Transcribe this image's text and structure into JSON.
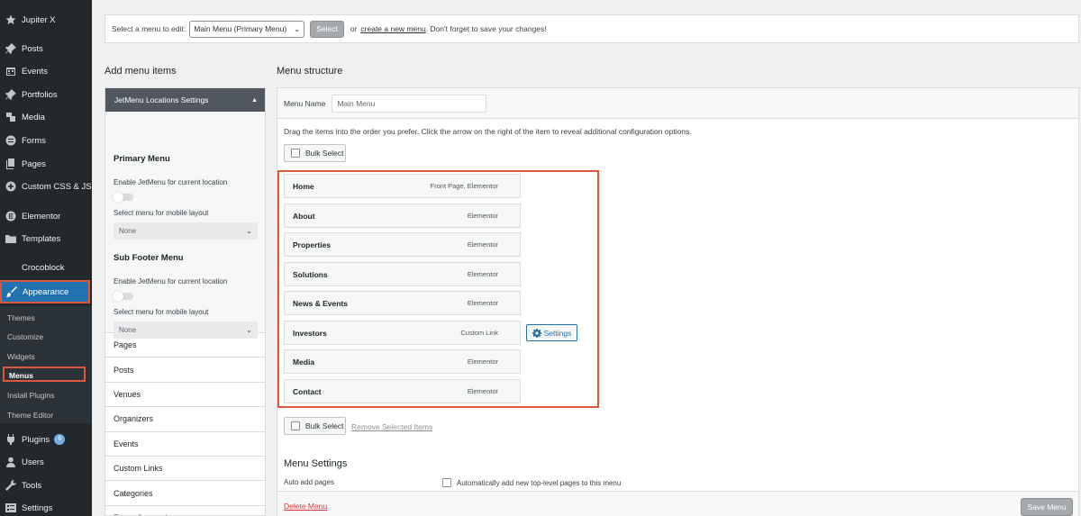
{
  "sidebar": {
    "items": [
      {
        "label": "Jupiter X",
        "icon": "star-icon"
      },
      {
        "label": "Posts",
        "icon": "pin-icon"
      },
      {
        "label": "Events",
        "icon": "calendar-icon"
      },
      {
        "label": "Portfolios",
        "icon": "pin-icon"
      },
      {
        "label": "Media",
        "icon": "media-icon"
      },
      {
        "label": "Forms",
        "icon": "forms-icon"
      },
      {
        "label": "Pages",
        "icon": "pages-icon"
      },
      {
        "label": "Custom CSS & JS",
        "icon": "plus-circle-icon"
      },
      {
        "label": "Elementor",
        "icon": "elementor-icon"
      },
      {
        "label": "Templates",
        "icon": "folder-icon"
      },
      {
        "label": "Crocoblock",
        "icon": "moon-icon"
      },
      {
        "label": "Appearance",
        "icon": "brush-icon"
      },
      {
        "label": "Plugins",
        "icon": "plug-icon",
        "badge": "6"
      },
      {
        "label": "Users",
        "icon": "user-icon"
      },
      {
        "label": "Tools",
        "icon": "wrench-icon"
      },
      {
        "label": "Settings",
        "icon": "settings-icon"
      }
    ],
    "submenu": [
      "Themes",
      "Customize",
      "Widgets",
      "Menus",
      "Install Plugins",
      "Theme Editor"
    ]
  },
  "select_bar": {
    "label": "Select a menu to edit:",
    "selected": "Main Menu (Primary Menu)",
    "select_button": "Select",
    "or": "or",
    "create_link": "create a new menu",
    "suffix": ". Don't forget to save your changes!"
  },
  "left": {
    "heading": "Add menu items",
    "jet_header": "JetMenu Locations Settings",
    "primary_title": "Primary Menu",
    "sub_footer_title": "Sub Footer Menu",
    "enable_label": "Enable JetMenu for current location",
    "mobile_label": "Select menu for mobile layout",
    "mobile_value": "None",
    "accordion": [
      "Pages",
      "Posts",
      "Venues",
      "Organizers",
      "Events",
      "Custom Links",
      "Categories",
      "Event Categories"
    ]
  },
  "right": {
    "heading": "Menu structure",
    "menu_name_label": "Menu Name",
    "menu_name_value": "Main Menu",
    "instructions": "Drag the items into the order you prefer. Click the arrow on the right of the item to reveal additional configuration options.",
    "bulk_select": "Bulk Select",
    "remove_selected": "Remove Selected Items",
    "settings_button": "Settings",
    "items": [
      {
        "title": "Home",
        "type": "Front Page, Elementor"
      },
      {
        "title": "About",
        "type": "Elementor"
      },
      {
        "title": "Properties",
        "type": "Elementor"
      },
      {
        "title": "Solutions",
        "type": "Elementor"
      },
      {
        "title": "News & Events",
        "type": "Elementor"
      },
      {
        "title": "Investors",
        "type": "Custom Link"
      },
      {
        "title": "Media",
        "type": "Elementor"
      },
      {
        "title": "Contact",
        "type": "Elementor"
      }
    ],
    "menu_settings_title": "Menu Settings",
    "auto_add_label": "Auto add pages",
    "auto_add_option": "Automatically add new top-level pages to this menu",
    "delete_menu": "Delete Menu",
    "save_menu": "Save Menu"
  },
  "colors": {
    "highlight": "#e0553d",
    "accent": "#2271b1",
    "sidebar": "#23282d"
  }
}
